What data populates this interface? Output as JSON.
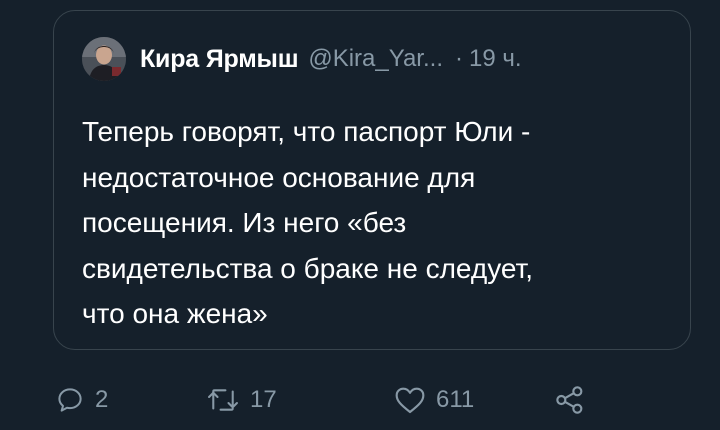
{
  "quoted_tweet": {
    "author_name": "Кира Ярмыш",
    "author_handle": "@Kira_Yar...",
    "separator": "·",
    "timestamp": "19 ч.",
    "text_lines": [
      "Теперь говорят, что паспорт Юли -",
      "недостаточное основание для",
      "посещения. Из него «без",
      "свидетельства о браке не следует,",
      "что она жена»"
    ]
  },
  "actions": {
    "reply": {
      "icon": "reply-icon",
      "count": "2"
    },
    "retweet": {
      "icon": "retweet-icon",
      "count": "17"
    },
    "like": {
      "icon": "heart-icon",
      "count": "611"
    },
    "share": {
      "icon": "share-icon"
    }
  },
  "colors": {
    "background": "#15202b",
    "border": "#38444d",
    "text_primary": "#ffffff",
    "text_secondary": "#8899a6"
  }
}
